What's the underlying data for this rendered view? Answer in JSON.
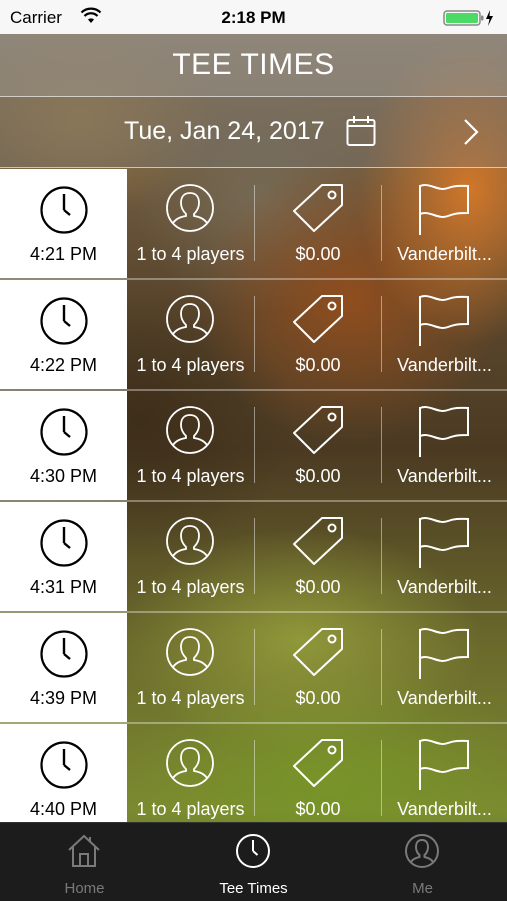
{
  "status_bar": {
    "carrier": "Carrier",
    "time": "2:18 PM"
  },
  "header": {
    "title": "TEE TIMES"
  },
  "date_bar": {
    "date": "Tue, Jan 24, 2017"
  },
  "tee_times": [
    {
      "time": "4:21 PM",
      "players": "1 to 4 players",
      "price": "$0.00",
      "course": "Vanderbilt..."
    },
    {
      "time": "4:22 PM",
      "players": "1 to 4 players",
      "price": "$0.00",
      "course": "Vanderbilt..."
    },
    {
      "time": "4:30 PM",
      "players": "1 to 4 players",
      "price": "$0.00",
      "course": "Vanderbilt..."
    },
    {
      "time": "4:31 PM",
      "players": "1 to 4 players",
      "price": "$0.00",
      "course": "Vanderbilt..."
    },
    {
      "time": "4:39 PM",
      "players": "1 to 4 players",
      "price": "$0.00",
      "course": "Vanderbilt..."
    },
    {
      "time": "4:40 PM",
      "players": "1 to 4 players",
      "price": "$0.00",
      "course": "Vanderbilt..."
    }
  ],
  "tab_bar": {
    "home": "Home",
    "tee_times": "Tee Times",
    "me": "Me",
    "active": "tee_times"
  },
  "colors": {
    "battery": "#4cd964",
    "tab_active": "#ffffff",
    "tab_inactive": "#7a7a7a"
  }
}
